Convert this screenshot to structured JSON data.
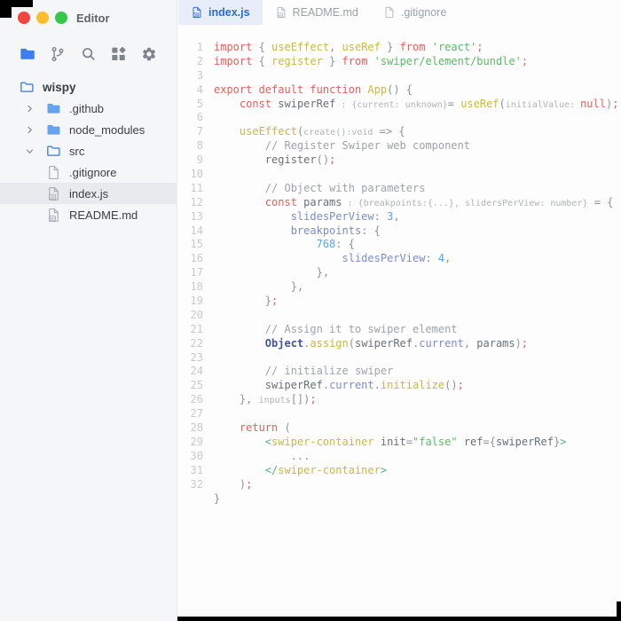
{
  "window": {
    "title": "Editor"
  },
  "colors": {
    "accent_blue": "#3c7ef0",
    "sidebar_bg": "#f5f6f8",
    "selected_row_bg": "#e8eaed",
    "tab_active_bg": "#e7eefa",
    "tab_active_text": "#2c6ad6",
    "traffic_red": "#f1453d",
    "traffic_yellow": "#fdbe2e",
    "traffic_green": "#34c749"
  },
  "activity_bar": {
    "items": [
      {
        "name": "explorer",
        "icon": "folder-icon",
        "active": true
      },
      {
        "name": "source-control",
        "icon": "git-branch-icon",
        "active": false
      },
      {
        "name": "search",
        "icon": "search-icon",
        "active": false
      },
      {
        "name": "extensions",
        "icon": "extensions-icon",
        "active": false
      },
      {
        "name": "settings",
        "icon": "gear-icon",
        "active": false
      }
    ]
  },
  "file_tree": {
    "items": [
      {
        "label": "wispy",
        "icon": "folder-open-outline-icon",
        "root": true,
        "chevron": null,
        "selected": false
      },
      {
        "label": ".github",
        "icon": "folder-filled-icon",
        "root": false,
        "chevron": "right",
        "selected": false
      },
      {
        "label": "node_modules",
        "icon": "folder-filled-icon",
        "root": false,
        "chevron": "right",
        "selected": false
      },
      {
        "label": "src",
        "icon": "folder-outline-icon",
        "root": false,
        "chevron": "down",
        "selected": false
      },
      {
        "label": ".gitignore",
        "icon": "file-icon",
        "root": false,
        "chevron": "none",
        "selected": false
      },
      {
        "label": "index.js",
        "icon": "file-js-icon",
        "root": false,
        "chevron": "none",
        "selected": true
      },
      {
        "label": "README.md",
        "icon": "file-md-icon",
        "root": false,
        "chevron": "none",
        "selected": false
      }
    ]
  },
  "tabs": [
    {
      "label": "index.js",
      "icon": "file-js-icon",
      "active": true
    },
    {
      "label": "README.md",
      "icon": "file-md-icon",
      "active": false
    },
    {
      "label": ".gitignore",
      "icon": "file-icon",
      "active": false
    }
  ],
  "code": {
    "token_colors": {
      "k": "#e0635a",
      "f": "#c8b943",
      "s": "#5cb865",
      "pr": "#7e8ccc",
      "n": "#58a6e6",
      "o": "#44549e",
      "p": "#8d949d",
      "t": "#6a717a",
      "c": "#9da4ab",
      "i": "#aeb4ba",
      "e": "#e0635a",
      "j": "#54ad96"
    },
    "lines": [
      {
        "n": "1",
        "t": [
          [
            "k",
            "import"
          ],
          [
            "p",
            " { "
          ],
          [
            "f",
            "useEffect"
          ],
          [
            "p",
            ", "
          ],
          [
            "f",
            "useRef"
          ],
          [
            "p",
            " } "
          ],
          [
            "k",
            "from"
          ],
          [
            "p",
            " "
          ],
          [
            "s",
            "'react'"
          ],
          [
            "e",
            ";"
          ]
        ]
      },
      {
        "n": "2",
        "t": [
          [
            "k",
            "import"
          ],
          [
            "p",
            " { "
          ],
          [
            "f",
            "register"
          ],
          [
            "p",
            " } "
          ],
          [
            "k",
            "from"
          ],
          [
            "p",
            " "
          ],
          [
            "s",
            "'swiper/element/bundle'"
          ],
          [
            "e",
            ";"
          ]
        ]
      },
      {
        "n": "3",
        "t": []
      },
      {
        "n": "4",
        "t": [
          [
            "k",
            "export default function"
          ],
          [
            "p",
            " "
          ],
          [
            "f",
            "App"
          ],
          [
            "p",
            "() {"
          ]
        ]
      },
      {
        "n": "5",
        "t": [
          [
            "p",
            "    "
          ],
          [
            "k",
            "const"
          ],
          [
            "p",
            " "
          ],
          [
            "t",
            "swiperRef"
          ],
          [
            "i",
            " : {current: unknown}"
          ],
          [
            "p",
            "= "
          ],
          [
            "f",
            "useRef"
          ],
          [
            "p",
            "("
          ],
          [
            "i",
            "initialValue: "
          ],
          [
            "k",
            "null"
          ],
          [
            "p",
            ")"
          ],
          [
            "e",
            ";"
          ]
        ]
      },
      {
        "n": "6",
        "t": []
      },
      {
        "n": "7",
        "t": [
          [
            "p",
            "    "
          ],
          [
            "f",
            "useEffect"
          ],
          [
            "p",
            "("
          ],
          [
            "i",
            "create():void"
          ],
          [
            "p",
            " => {"
          ]
        ]
      },
      {
        "n": "8",
        "t": [
          [
            "c",
            "        // Register Swiper web component"
          ]
        ]
      },
      {
        "n": "9",
        "t": [
          [
            "p",
            "        "
          ],
          [
            "t",
            "register"
          ],
          [
            "p",
            "()"
          ],
          [
            "e",
            ";"
          ]
        ]
      },
      {
        "n": "10",
        "t": []
      },
      {
        "n": "11",
        "t": [
          [
            "c",
            "        // Object with parameters"
          ]
        ]
      },
      {
        "n": "12",
        "t": [
          [
            "p",
            "        "
          ],
          [
            "k",
            "const"
          ],
          [
            "p",
            " "
          ],
          [
            "t",
            "params"
          ],
          [
            "i",
            " : {breakpoints:{...}, slidersPerView: number}"
          ],
          [
            "p",
            " = {"
          ]
        ]
      },
      {
        "n": "13",
        "t": [
          [
            "p",
            "            "
          ],
          [
            "pr",
            "slidesPerView"
          ],
          [
            "p",
            ": "
          ],
          [
            "n",
            "3"
          ],
          [
            "p",
            ","
          ]
        ]
      },
      {
        "n": "14",
        "t": [
          [
            "p",
            "            "
          ],
          [
            "pr",
            "breakpoints"
          ],
          [
            "p",
            ": {"
          ]
        ]
      },
      {
        "n": "15",
        "t": [
          [
            "p",
            "                "
          ],
          [
            "n",
            "768"
          ],
          [
            "p",
            ": {"
          ]
        ]
      },
      {
        "n": "16",
        "t": [
          [
            "p",
            "                    "
          ],
          [
            "pr",
            "slidesPerView"
          ],
          [
            "p",
            ": "
          ],
          [
            "n",
            "4"
          ],
          [
            "p",
            ","
          ]
        ]
      },
      {
        "n": "17",
        "t": [
          [
            "p",
            "                },"
          ]
        ]
      },
      {
        "n": "18",
        "t": [
          [
            "p",
            "            },"
          ]
        ]
      },
      {
        "n": "19",
        "t": [
          [
            "p",
            "        }"
          ],
          [
            "e",
            ";"
          ]
        ]
      },
      {
        "n": "20",
        "t": []
      },
      {
        "n": "21",
        "t": [
          [
            "c",
            "        // Assign it to swiper element"
          ]
        ]
      },
      {
        "n": "22",
        "t": [
          [
            "p",
            "        "
          ],
          [
            "o",
            "Object"
          ],
          [
            "p",
            "."
          ],
          [
            "f",
            "assign"
          ],
          [
            "p",
            "("
          ],
          [
            "t",
            "swiperRef"
          ],
          [
            "p",
            "."
          ],
          [
            "pr",
            "current"
          ],
          [
            "p",
            ", "
          ],
          [
            "t",
            "params"
          ],
          [
            "p",
            ")"
          ],
          [
            "e",
            ";"
          ]
        ]
      },
      {
        "n": "23",
        "t": []
      },
      {
        "n": "24",
        "t": [
          [
            "c",
            "        // initialize swiper"
          ]
        ]
      },
      {
        "n": "25",
        "t": [
          [
            "p",
            "        "
          ],
          [
            "t",
            "swiperRef"
          ],
          [
            "p",
            "."
          ],
          [
            "pr",
            "current"
          ],
          [
            "p",
            "."
          ],
          [
            "f",
            "initialize"
          ],
          [
            "p",
            "()"
          ],
          [
            "e",
            ";"
          ]
        ]
      },
      {
        "n": "26",
        "t": [
          [
            "p",
            "    }, "
          ],
          [
            "i",
            "inputs"
          ],
          [
            "p",
            "[])"
          ],
          [
            "e",
            ";"
          ]
        ]
      },
      {
        "n": "27",
        "t": []
      },
      {
        "n": "28",
        "t": [
          [
            "p",
            "    "
          ],
          [
            "k",
            "return"
          ],
          [
            "p",
            " ("
          ]
        ]
      },
      {
        "n": "29",
        "t": [
          [
            "p",
            "        "
          ],
          [
            "j",
            "<"
          ],
          [
            "f",
            "swiper-container"
          ],
          [
            "p",
            " "
          ],
          [
            "t",
            "init"
          ],
          [
            "p",
            "="
          ],
          [
            "s",
            "\"false\""
          ],
          [
            "p",
            " "
          ],
          [
            "t",
            "ref"
          ],
          [
            "p",
            "={"
          ],
          [
            "t",
            "swiperRef"
          ],
          [
            "p",
            "}"
          ],
          [
            "j",
            ">"
          ]
        ]
      },
      {
        "n": "30",
        "t": [
          [
            "p",
            "            ..."
          ]
        ]
      },
      {
        "n": "31",
        "t": [
          [
            "p",
            "        "
          ],
          [
            "j",
            "</"
          ],
          [
            "f",
            "swiper-container"
          ],
          [
            "j",
            ">"
          ]
        ]
      },
      {
        "n": "32",
        "t": [
          [
            "p",
            "    )"
          ],
          [
            "e",
            ";"
          ]
        ]
      },
      {
        "n": "",
        "t": [
          [
            "p",
            "}"
          ]
        ]
      }
    ]
  }
}
